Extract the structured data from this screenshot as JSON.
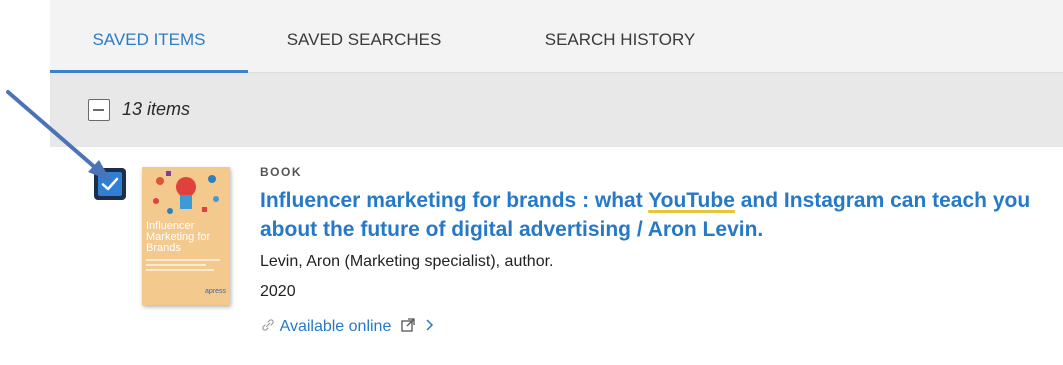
{
  "tabs": [
    {
      "label": "SAVED ITEMS",
      "active": true
    },
    {
      "label": "SAVED SEARCHES",
      "active": false
    },
    {
      "label": "SEARCH HISTORY",
      "active": false
    }
  ],
  "itembar": {
    "count_label": "13 items"
  },
  "result": {
    "checked": true,
    "type": "BOOK",
    "title_before": "Influencer marketing for brands : what ",
    "title_highlight": "YouTube",
    "title_after": " and Instagram can teach you about the future of digital advertising / Aron Levin.",
    "author": "Levin, Aron (Marketing specialist), author.",
    "year": "2020",
    "availability": "Available online",
    "cover": {
      "title_line1": "Influencer",
      "title_line2": "Marketing for",
      "title_line3": "Brands",
      "publisher": "apress"
    }
  },
  "colors": {
    "accent": "#2679c7",
    "tab_active": "#2e7bc4",
    "highlight": "#e7c53b",
    "annotation_arrow": "#4a73b8"
  },
  "icons": {
    "link": "link-icon",
    "external": "external-link-icon",
    "chevron": "chevron-right-icon",
    "check": "check-icon"
  }
}
